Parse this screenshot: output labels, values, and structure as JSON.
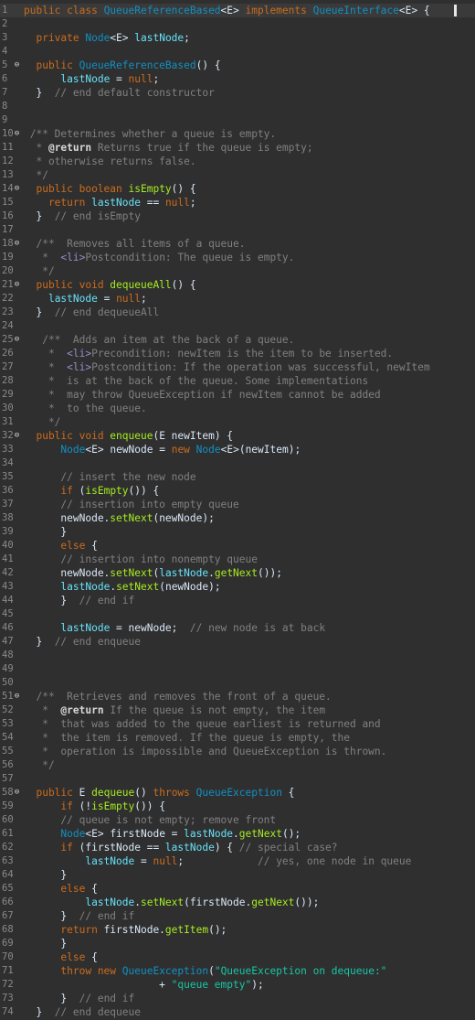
{
  "editor": {
    "fold_icon": "⊖",
    "colors": {
      "background": "#2f2f2f",
      "keyword": "#cc6c1d",
      "type": "#1290c3",
      "field": "#66e1f8",
      "method": "#a7ec21",
      "string": "#17c6a3",
      "comment": "#808080",
      "javadoc_tag": "#9a8cc9"
    },
    "lines": [
      {
        "n": "1",
        "fold": false,
        "t": [
          [
            "kw",
            "public class "
          ],
          [
            "typ",
            "QueueReferenceBased"
          ],
          [
            "pl",
            "<E> "
          ],
          [
            "kw",
            "implements "
          ],
          [
            "typ",
            "QueueInterface"
          ],
          [
            "pl",
            "<E> {"
          ]
        ]
      },
      {
        "n": "2",
        "fold": false,
        "t": []
      },
      {
        "n": "3",
        "fold": false,
        "t": [
          [
            "kw",
            "  private "
          ],
          [
            "typ",
            "Node"
          ],
          [
            "pl",
            "<E> "
          ],
          [
            "fld",
            "lastNode"
          ],
          [
            "pl",
            ";"
          ]
        ]
      },
      {
        "n": "4",
        "fold": false,
        "t": []
      },
      {
        "n": "5",
        "fold": true,
        "t": [
          [
            "kw",
            "  public "
          ],
          [
            "typ",
            "QueueReferenceBased"
          ],
          [
            "pl",
            "() {"
          ]
        ]
      },
      {
        "n": "6",
        "fold": false,
        "t": [
          [
            "pl",
            "      "
          ],
          [
            "fld",
            "lastNode"
          ],
          [
            "pl",
            " = "
          ],
          [
            "kw",
            "null"
          ],
          [
            "pl",
            ";"
          ]
        ]
      },
      {
        "n": "7",
        "fold": false,
        "t": [
          [
            "pl",
            "  }  "
          ],
          [
            "cmt",
            "// end default constructor"
          ]
        ]
      },
      {
        "n": "8",
        "fold": false,
        "t": []
      },
      {
        "n": "9",
        "fold": false,
        "t": []
      },
      {
        "n": "10",
        "fold": true,
        "t": [
          [
            "cmt",
            " /** Determines whether a queue is empty."
          ]
        ]
      },
      {
        "n": "11",
        "fold": false,
        "t": [
          [
            "cmt",
            "  * "
          ],
          [
            "ann",
            "@return"
          ],
          [
            "cmt",
            " Returns true if the queue is empty;"
          ]
        ]
      },
      {
        "n": "12",
        "fold": false,
        "t": [
          [
            "cmt",
            "  * otherwise returns false."
          ]
        ]
      },
      {
        "n": "13",
        "fold": false,
        "t": [
          [
            "cmt",
            "  */"
          ]
        ]
      },
      {
        "n": "14",
        "fold": true,
        "t": [
          [
            "kw",
            "  public boolean "
          ],
          [
            "mth",
            "isEmpty"
          ],
          [
            "pl",
            "() {"
          ]
        ]
      },
      {
        "n": "15",
        "fold": false,
        "t": [
          [
            "kw",
            "    return "
          ],
          [
            "fld",
            "lastNode"
          ],
          [
            "pl",
            " == "
          ],
          [
            "kw",
            "null"
          ],
          [
            "pl",
            ";"
          ]
        ]
      },
      {
        "n": "16",
        "fold": false,
        "t": [
          [
            "pl",
            "  }  "
          ],
          [
            "cmt",
            "// end isEmpty"
          ]
        ]
      },
      {
        "n": "17",
        "fold": false,
        "t": []
      },
      {
        "n": "18",
        "fold": true,
        "t": [
          [
            "cmt",
            "  /**  Removes all items of a queue."
          ]
        ]
      },
      {
        "n": "19",
        "fold": false,
        "t": [
          [
            "cmt",
            "   *  "
          ],
          [
            "tag",
            "<li>"
          ],
          [
            "cmt",
            "Postcondition: The queue is empty."
          ]
        ]
      },
      {
        "n": "20",
        "fold": false,
        "t": [
          [
            "cmt",
            "   */"
          ]
        ]
      },
      {
        "n": "21",
        "fold": true,
        "t": [
          [
            "kw",
            "  public void "
          ],
          [
            "mth",
            "dequeueAll"
          ],
          [
            "pl",
            "() {"
          ]
        ]
      },
      {
        "n": "22",
        "fold": false,
        "t": [
          [
            "pl",
            "    "
          ],
          [
            "fld",
            "lastNode"
          ],
          [
            "pl",
            " = "
          ],
          [
            "kw",
            "null"
          ],
          [
            "pl",
            ";"
          ]
        ]
      },
      {
        "n": "23",
        "fold": false,
        "t": [
          [
            "pl",
            "  }  "
          ],
          [
            "cmt",
            "// end dequeueAll"
          ]
        ]
      },
      {
        "n": "24",
        "fold": false,
        "t": []
      },
      {
        "n": "25",
        "fold": true,
        "t": [
          [
            "cmt",
            "   /**  Adds an item at the back of a queue."
          ]
        ]
      },
      {
        "n": "26",
        "fold": false,
        "t": [
          [
            "cmt",
            "    *  "
          ],
          [
            "tag",
            "<li>"
          ],
          [
            "cmt",
            "Precondition: newItem is the item to be inserted."
          ]
        ]
      },
      {
        "n": "27",
        "fold": false,
        "t": [
          [
            "cmt",
            "    *  "
          ],
          [
            "tag",
            "<li>"
          ],
          [
            "cmt",
            "Postcondition: If the operation was successful, newItem"
          ]
        ]
      },
      {
        "n": "28",
        "fold": false,
        "t": [
          [
            "cmt",
            "    *  is at the back of the queue. Some implementations"
          ]
        ]
      },
      {
        "n": "29",
        "fold": false,
        "t": [
          [
            "cmt",
            "    *  may throw QueueException if newItem cannot be added"
          ]
        ]
      },
      {
        "n": "30",
        "fold": false,
        "t": [
          [
            "cmt",
            "    *  to the queue."
          ]
        ]
      },
      {
        "n": "31",
        "fold": false,
        "t": [
          [
            "cmt",
            "    */"
          ]
        ]
      },
      {
        "n": "32",
        "fold": true,
        "t": [
          [
            "kw",
            "  public void "
          ],
          [
            "mth",
            "enqueue"
          ],
          [
            "pl",
            "(E "
          ],
          [
            "pl",
            "newItem"
          ],
          [
            "pl",
            ") {"
          ]
        ]
      },
      {
        "n": "33",
        "fold": false,
        "t": [
          [
            "pl",
            "      "
          ],
          [
            "typ",
            "Node"
          ],
          [
            "pl",
            "<E> "
          ],
          [
            "pl",
            "newNode"
          ],
          [
            "pl",
            " = "
          ],
          [
            "kw",
            "new "
          ],
          [
            "typ",
            "Node"
          ],
          [
            "pl",
            "<E>("
          ],
          [
            "pl",
            "newItem"
          ],
          [
            "pl",
            ");"
          ]
        ]
      },
      {
        "n": "34",
        "fold": false,
        "t": []
      },
      {
        "n": "35",
        "fold": false,
        "t": [
          [
            "cmt",
            "      // insert the new node"
          ]
        ]
      },
      {
        "n": "36",
        "fold": false,
        "t": [
          [
            "kw",
            "      if "
          ],
          [
            "pl",
            "("
          ],
          [
            "mth",
            "isEmpty"
          ],
          [
            "pl",
            "()) {"
          ]
        ]
      },
      {
        "n": "37",
        "fold": false,
        "t": [
          [
            "cmt",
            "      // insertion into empty queue"
          ]
        ]
      },
      {
        "n": "38",
        "fold": false,
        "t": [
          [
            "pl",
            "      newNode."
          ],
          [
            "mth",
            "setNext"
          ],
          [
            "pl",
            "(newNode);"
          ]
        ]
      },
      {
        "n": "39",
        "fold": false,
        "t": [
          [
            "pl",
            "      }"
          ]
        ]
      },
      {
        "n": "40",
        "fold": false,
        "t": [
          [
            "kw",
            "      else "
          ],
          [
            "pl",
            "{"
          ]
        ]
      },
      {
        "n": "41",
        "fold": false,
        "t": [
          [
            "cmt",
            "      // insertion into nonempty queue"
          ]
        ]
      },
      {
        "n": "42",
        "fold": false,
        "t": [
          [
            "pl",
            "      newNode."
          ],
          [
            "mth",
            "setNext"
          ],
          [
            "pl",
            "("
          ],
          [
            "fld",
            "lastNode"
          ],
          [
            "pl",
            "."
          ],
          [
            "mth",
            "getNext"
          ],
          [
            "pl",
            "());"
          ]
        ]
      },
      {
        "n": "43",
        "fold": false,
        "t": [
          [
            "pl",
            "      "
          ],
          [
            "fld",
            "lastNode"
          ],
          [
            "pl",
            "."
          ],
          [
            "mth",
            "setNext"
          ],
          [
            "pl",
            "(newNode);"
          ]
        ]
      },
      {
        "n": "44",
        "fold": false,
        "t": [
          [
            "pl",
            "      }  "
          ],
          [
            "cmt",
            "// end if"
          ]
        ]
      },
      {
        "n": "45",
        "fold": false,
        "t": []
      },
      {
        "n": "46",
        "fold": false,
        "t": [
          [
            "pl",
            "      "
          ],
          [
            "fld",
            "lastNode"
          ],
          [
            "pl",
            " = newNode;  "
          ],
          [
            "cmt",
            "// new node is at back"
          ]
        ]
      },
      {
        "n": "47",
        "fold": false,
        "t": [
          [
            "pl",
            "  }  "
          ],
          [
            "cmt",
            "// end enqueue"
          ]
        ]
      },
      {
        "n": "48",
        "fold": false,
        "t": []
      },
      {
        "n": "49",
        "fold": false,
        "t": []
      },
      {
        "n": "50",
        "fold": false,
        "t": []
      },
      {
        "n": "51",
        "fold": true,
        "t": [
          [
            "cmt",
            "  /**  Retrieves and removes the front of a queue."
          ]
        ]
      },
      {
        "n": "52",
        "fold": false,
        "t": [
          [
            "cmt",
            "   *  "
          ],
          [
            "ann",
            "@return"
          ],
          [
            "cmt",
            " If the queue is not empty, the item"
          ]
        ]
      },
      {
        "n": "53",
        "fold": false,
        "t": [
          [
            "cmt",
            "   *  that was added to the queue earliest is returned and"
          ]
        ]
      },
      {
        "n": "54",
        "fold": false,
        "t": [
          [
            "cmt",
            "   *  the item is removed. If the queue is empty, the"
          ]
        ]
      },
      {
        "n": "55",
        "fold": false,
        "t": [
          [
            "cmt",
            "   *  operation is impossible and QueueException is thrown."
          ]
        ]
      },
      {
        "n": "56",
        "fold": false,
        "t": [
          [
            "cmt",
            "   */"
          ]
        ]
      },
      {
        "n": "57",
        "fold": false,
        "t": []
      },
      {
        "n": "58",
        "fold": true,
        "t": [
          [
            "kw",
            "  public "
          ],
          [
            "pl",
            "E "
          ],
          [
            "mth",
            "dequeue"
          ],
          [
            "pl",
            "() "
          ],
          [
            "kw",
            "throws "
          ],
          [
            "typ",
            "QueueException"
          ],
          [
            "pl",
            " {"
          ]
        ]
      },
      {
        "n": "59",
        "fold": false,
        "t": [
          [
            "kw",
            "      if "
          ],
          [
            "pl",
            "(!"
          ],
          [
            "mth",
            "isEmpty"
          ],
          [
            "pl",
            "()) {"
          ]
        ]
      },
      {
        "n": "60",
        "fold": false,
        "t": [
          [
            "cmt",
            "      // queue is not empty; remove front"
          ]
        ]
      },
      {
        "n": "61",
        "fold": false,
        "t": [
          [
            "pl",
            "      "
          ],
          [
            "typ",
            "Node"
          ],
          [
            "pl",
            "<E> firstNode = "
          ],
          [
            "fld",
            "lastNode"
          ],
          [
            "pl",
            "."
          ],
          [
            "mth",
            "getNext"
          ],
          [
            "pl",
            "();"
          ]
        ]
      },
      {
        "n": "62",
        "fold": false,
        "t": [
          [
            "kw",
            "      if "
          ],
          [
            "pl",
            "(firstNode == "
          ],
          [
            "fld",
            "lastNode"
          ],
          [
            "pl",
            ") { "
          ],
          [
            "cmt",
            "// special case?"
          ]
        ]
      },
      {
        "n": "63",
        "fold": false,
        "t": [
          [
            "pl",
            "          "
          ],
          [
            "fld",
            "lastNode"
          ],
          [
            "pl",
            " = "
          ],
          [
            "kw",
            "null"
          ],
          [
            "pl",
            ";            "
          ],
          [
            "cmt",
            "// yes, one node in queue"
          ]
        ]
      },
      {
        "n": "64",
        "fold": false,
        "t": [
          [
            "pl",
            "      }"
          ]
        ]
      },
      {
        "n": "65",
        "fold": false,
        "t": [
          [
            "kw",
            "      else "
          ],
          [
            "pl",
            "{"
          ]
        ]
      },
      {
        "n": "66",
        "fold": false,
        "t": [
          [
            "pl",
            "          "
          ],
          [
            "fld",
            "lastNode"
          ],
          [
            "pl",
            "."
          ],
          [
            "mth",
            "setNext"
          ],
          [
            "pl",
            "(firstNode."
          ],
          [
            "mth",
            "getNext"
          ],
          [
            "pl",
            "());"
          ]
        ]
      },
      {
        "n": "67",
        "fold": false,
        "t": [
          [
            "pl",
            "      }  "
          ],
          [
            "cmt",
            "// end if"
          ]
        ]
      },
      {
        "n": "68",
        "fold": false,
        "t": [
          [
            "kw",
            "      return "
          ],
          [
            "pl",
            "firstNode."
          ],
          [
            "mth",
            "getItem"
          ],
          [
            "pl",
            "();"
          ]
        ]
      },
      {
        "n": "69",
        "fold": false,
        "t": [
          [
            "pl",
            "      }"
          ]
        ]
      },
      {
        "n": "70",
        "fold": false,
        "t": [
          [
            "kw",
            "      else "
          ],
          [
            "pl",
            "{"
          ]
        ]
      },
      {
        "n": "71",
        "fold": false,
        "t": [
          [
            "kw",
            "      throw new "
          ],
          [
            "typ",
            "QueueException"
          ],
          [
            "pl",
            "("
          ],
          [
            "str",
            "\"QueueException on dequeue:\""
          ]
        ]
      },
      {
        "n": "72",
        "fold": false,
        "t": [
          [
            "pl",
            "                      + "
          ],
          [
            "str",
            "\"queue empty\""
          ],
          [
            "pl",
            ");"
          ]
        ]
      },
      {
        "n": "73",
        "fold": false,
        "t": [
          [
            "pl",
            "      }  "
          ],
          [
            "cmt",
            "// end if"
          ]
        ]
      },
      {
        "n": "74",
        "fold": false,
        "t": [
          [
            "pl",
            "  }  "
          ],
          [
            "cmt",
            "// end dequeue"
          ]
        ]
      }
    ]
  }
}
